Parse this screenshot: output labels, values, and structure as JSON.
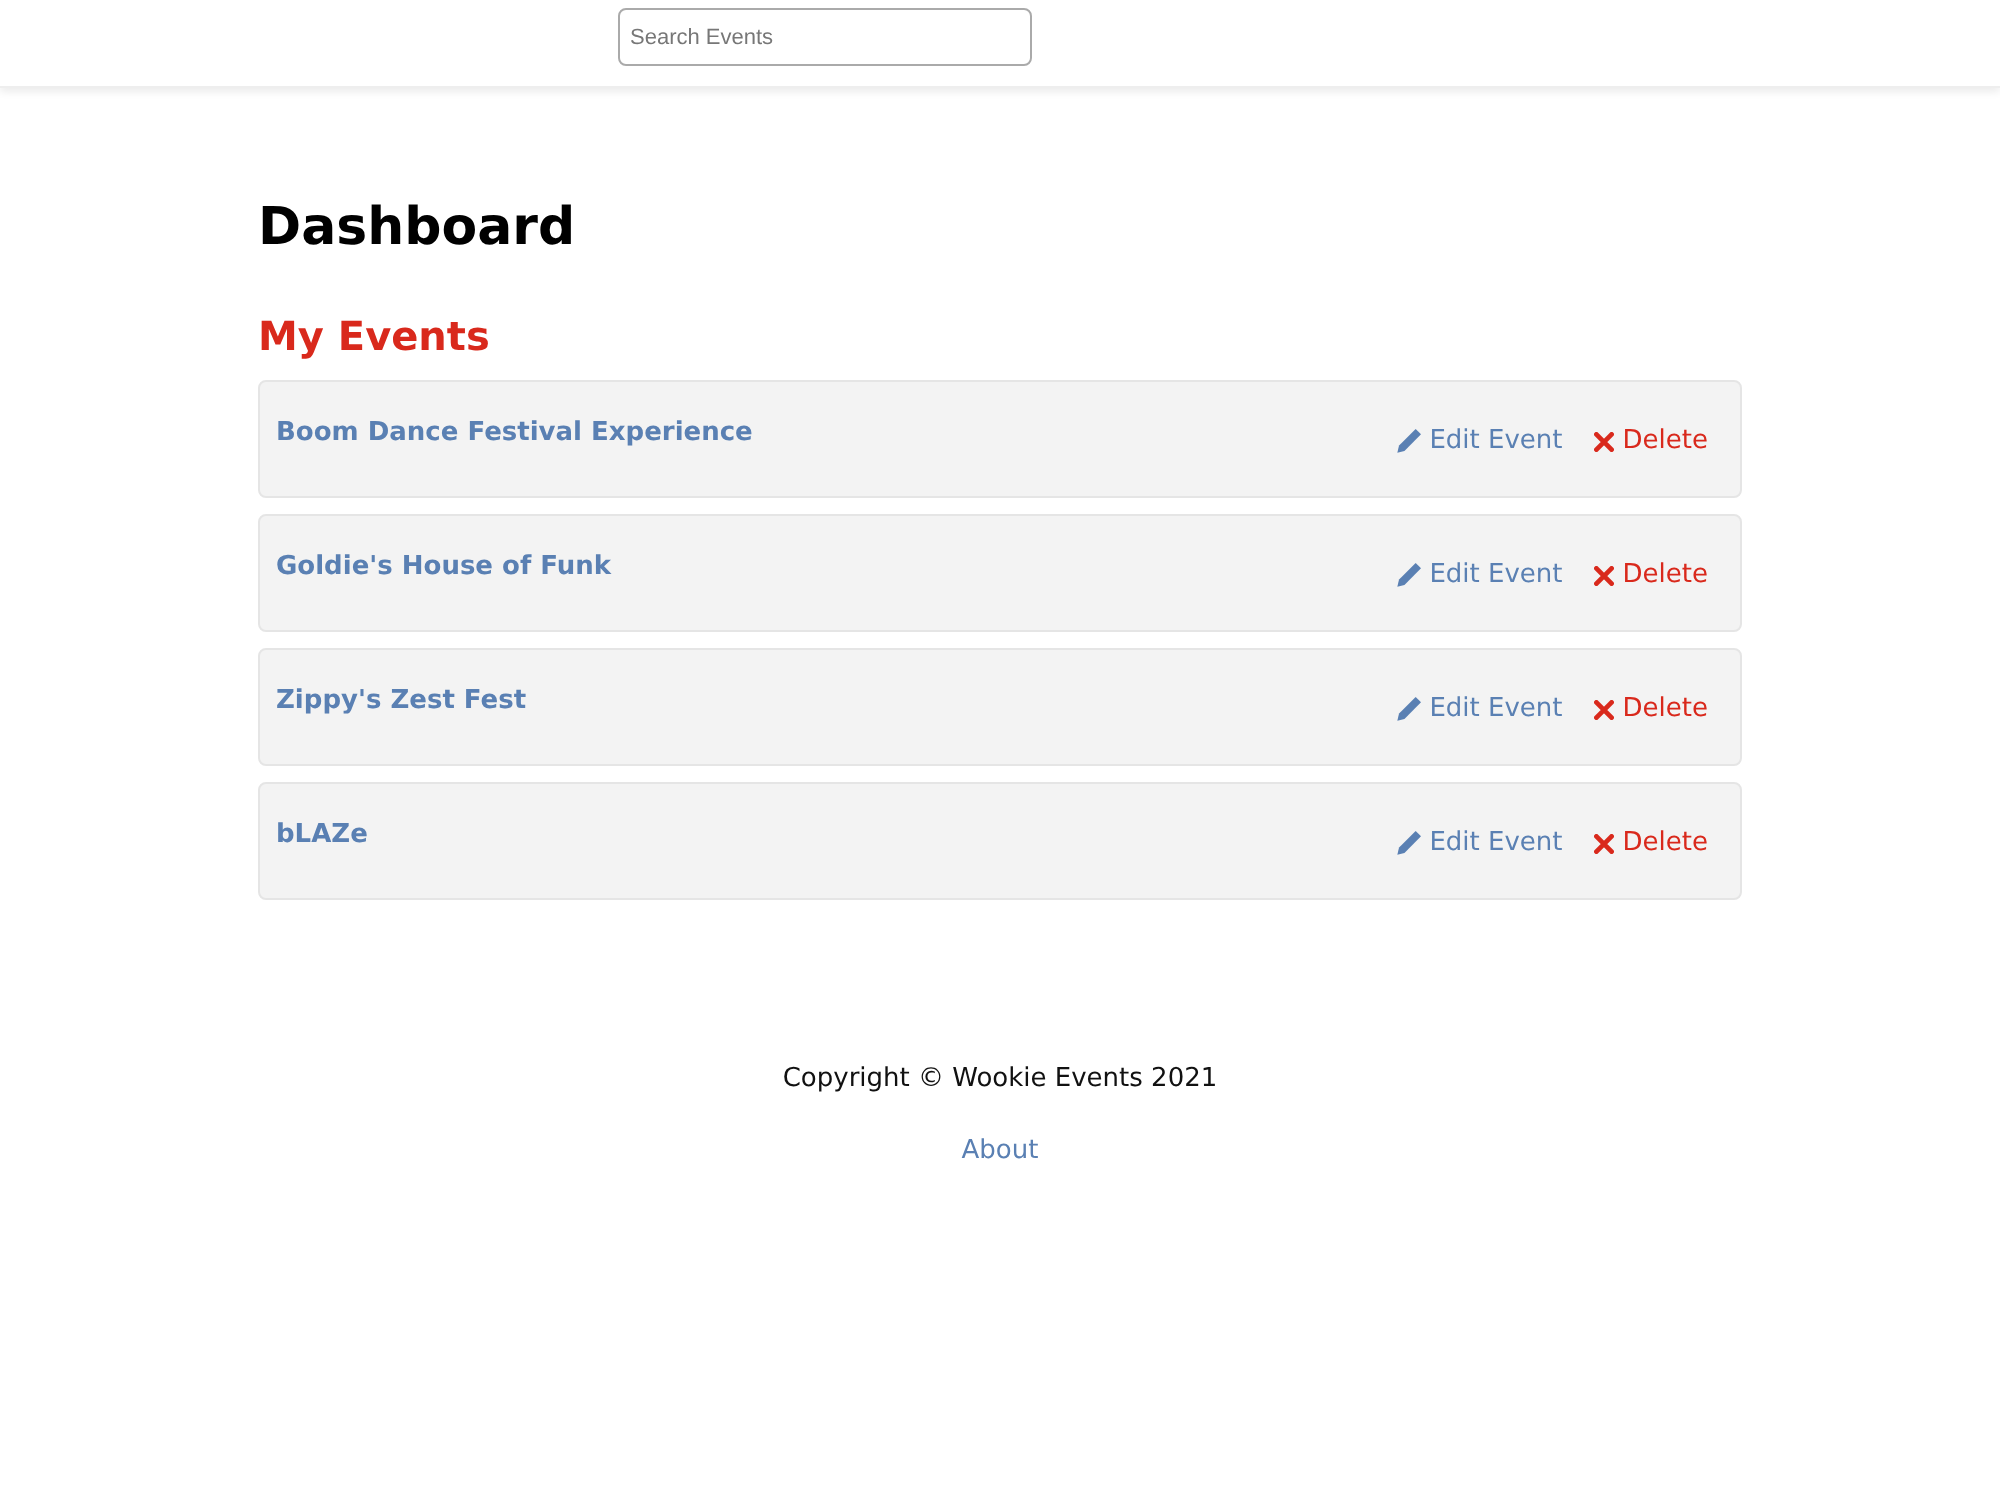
{
  "header": {
    "search": {
      "placeholder": "Search Events"
    }
  },
  "page": {
    "title": "Dashboard",
    "section_title": "My Events"
  },
  "events": [
    {
      "title": "Boom Dance Festival Experience",
      "edit": "Edit Event",
      "delete": "Delete"
    },
    {
      "title": "Goldie's House of Funk",
      "edit": "Edit Event",
      "delete": "Delete"
    },
    {
      "title": "Zippy's Zest Fest",
      "edit": "Edit Event",
      "delete": "Delete"
    },
    {
      "title": "bLAZe",
      "edit": "Edit Event",
      "delete": "Delete"
    }
  ],
  "footer": {
    "copyright": "Copyright © Wookie Events 2021",
    "link": "About"
  }
}
